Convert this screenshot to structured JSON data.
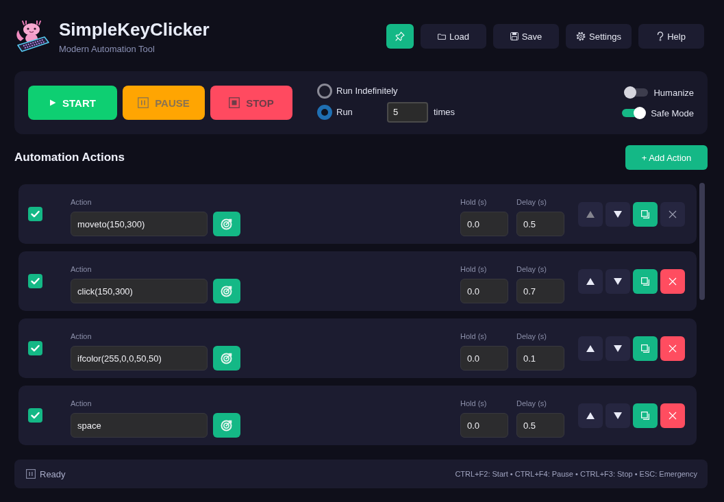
{
  "header": {
    "title": "SimpleKeyClicker",
    "subtitle": "Modern Automation Tool"
  },
  "toolbar": {
    "pin": {
      "pinned": true
    },
    "buttons": [
      {
        "kind": "load",
        "label": "Load"
      },
      {
        "kind": "save",
        "label": "Save"
      },
      {
        "kind": "settings",
        "label": "Settings"
      },
      {
        "kind": "help",
        "label": "Help"
      }
    ]
  },
  "controls": {
    "buttons": [
      {
        "kind": "start",
        "label": "START",
        "disabled": false
      },
      {
        "kind": "pause",
        "label": "PAUSE",
        "disabled": true
      },
      {
        "kind": "stop",
        "label": "STOP",
        "disabled": true
      }
    ],
    "run_modes": [
      {
        "label": "Run Indefinitely",
        "selected": false
      },
      {
        "label": "Run",
        "selected": true,
        "count": "5",
        "count_suffix": "times"
      }
    ],
    "toggles": [
      {
        "label": "Humanize",
        "on": false
      },
      {
        "label": "Safe Mode",
        "on": true
      }
    ]
  },
  "actions_section": {
    "title": "Automation Actions",
    "add_button": "+ Add Action"
  },
  "actions": [
    {
      "checked": true,
      "action_label": "Action",
      "action": "moveto(150,300)",
      "hold_label": "Hold (s)",
      "hold": "0.0",
      "delay_label": "Delay (s)",
      "delay": "0.5",
      "move_up_disabled": true,
      "move_down_disabled": false,
      "delete_disabled": true
    },
    {
      "checked": true,
      "action_label": "Action",
      "action": "click(150,300)",
      "hold_label": "Hold (s)",
      "hold": "0.0",
      "delay_label": "Delay (s)",
      "delay": "0.7",
      "move_up_disabled": false,
      "move_down_disabled": false,
      "delete_disabled": false
    },
    {
      "checked": true,
      "action_label": "Action",
      "action": "ifcolor(255,0,0,50,50)",
      "hold_label": "Hold (s)",
      "hold": "0.0",
      "delay_label": "Delay (s)",
      "delay": "0.1",
      "move_up_disabled": false,
      "move_down_disabled": false,
      "delete_disabled": false
    },
    {
      "checked": true,
      "action_label": "Action",
      "action": "space",
      "hold_label": "Hold (s)",
      "hold": "0.0",
      "delay_label": "Delay (s)",
      "delay": "0.5",
      "move_up_disabled": false,
      "move_down_disabled": false,
      "delete_disabled": false
    }
  ],
  "status_bar": {
    "state": "Ready",
    "shortcuts": "CTRL+F2: Start • CTRL+F4: Pause • CTRL+F3: Stop • ESC: Emergency"
  }
}
